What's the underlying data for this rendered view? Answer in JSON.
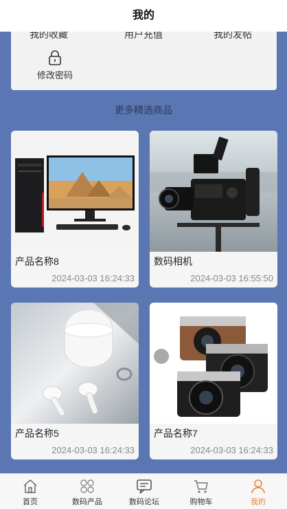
{
  "header": {
    "title": "我的"
  },
  "menu": {
    "cut_row": [
      "我的收藏",
      "用户充值",
      "我的发帖"
    ],
    "change_password_label": "修改密码"
  },
  "section_title": "更多精选商品",
  "products": [
    {
      "name": "产品名称8",
      "time": "2024-03-03 16:24:33",
      "image": "desktop-computer"
    },
    {
      "name": "数码相机",
      "time": "2024-03-03 16:55:50",
      "image": "video-camera"
    },
    {
      "name": "产品名称5",
      "time": "2024-03-03 16:24:33",
      "image": "earbuds"
    },
    {
      "name": "产品名称7",
      "time": "2024-03-03 16:24:33",
      "image": "cameras"
    }
  ],
  "tabbar": {
    "items": [
      {
        "label": "首页",
        "icon": "home-icon"
      },
      {
        "label": "数码产品",
        "icon": "grid-icon"
      },
      {
        "label": "数码论坛",
        "icon": "forum-icon"
      },
      {
        "label": "购物车",
        "icon": "cart-icon"
      },
      {
        "label": "我的",
        "icon": "user-icon"
      }
    ],
    "active_color": "#e8823b"
  },
  "colors": {
    "background": "#5a77b3",
    "accent": "#e8823b"
  }
}
